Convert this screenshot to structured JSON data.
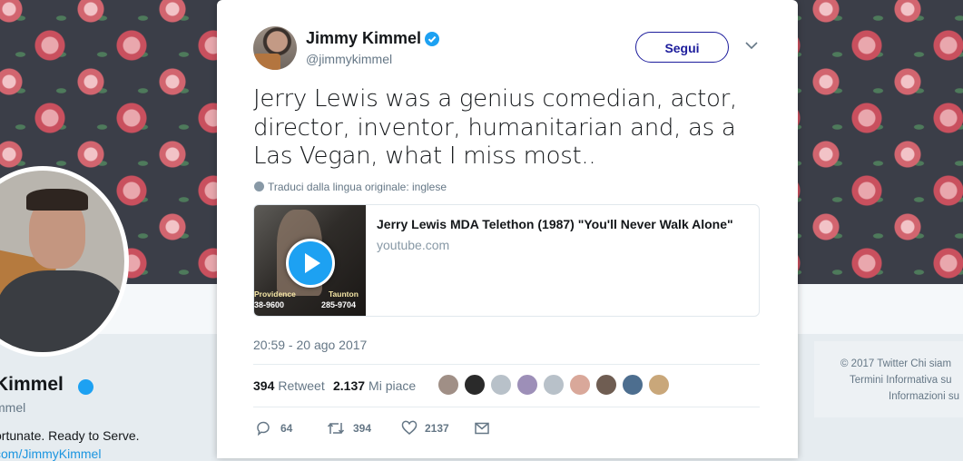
{
  "background": {
    "profile_name": "Kimmel",
    "profile_handle": "mmel",
    "bio": "ortunate. Ready to Serve.",
    "link": "com/JimmyKimmel",
    "footer": {
      "line1": "© 2017 Twitter   Chi siam",
      "line2": "Termini   Informativa su",
      "line3": "Informazioni su"
    }
  },
  "tweet": {
    "author_name": "Jimmy Kimmel",
    "author_handle": "@jimmykimmel",
    "follow_label": "Segui",
    "text": "Jerry Lewis was a genius comedian, actor, director, inventor, humanitarian and, as a Las Vegan, what I miss most..",
    "translate_label": "Traduci dalla lingua originale: inglese",
    "card": {
      "title": "Jerry Lewis MDA Telethon (1987) \"You'll Never Walk Alone\"",
      "domain": "youtube.com",
      "overlay_left_top": "Providence",
      "overlay_left_bottom": "38-9600",
      "overlay_right_top": "Taunton",
      "overlay_right_bottom": "285-9704"
    },
    "timestamp": "20:59 - 20 ago 2017",
    "retweet_count": "394",
    "retweet_label": "Retweet",
    "like_count": "2.137",
    "like_label": "Mi piace",
    "actions": {
      "reply_count": "64",
      "retweet_count": "394",
      "like_count": "2137"
    },
    "liker_colors": [
      "#a08f86",
      "#2a2a2a",
      "#b8c1c9",
      "#9d8fb8",
      "#b8c1c9",
      "#d9a89a",
      "#6f5d52",
      "#4d6e8f",
      "#c9a77a"
    ],
    "colors": {
      "verified": "#1da1f2",
      "follow_border": "#1c1c9c",
      "meta_text": "#657786"
    }
  }
}
